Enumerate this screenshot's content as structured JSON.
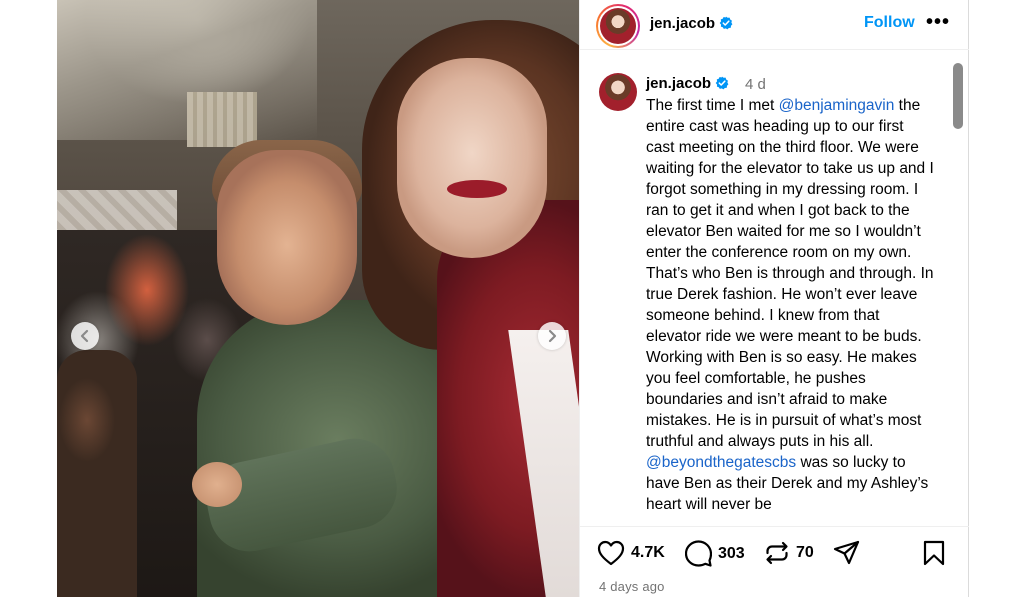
{
  "post": {
    "username": "jen.jacob",
    "follow_label": "Follow",
    "more_label": "•••"
  },
  "caption": {
    "username": "jen.jacob",
    "time": "4 d",
    "text_1": "The first time I met ",
    "mention_1": "@benjamingavin",
    "text_2": " the entire cast was heading up to our first cast meeting on the third floor. We were waiting for the elevator to take us up and I forgot something in my dressing room. I ran to get it and when I got back to the elevator Ben waited for me so I wouldn’t enter the conference room on my own. That’s who Ben is through and through. In true Derek fashion. He won’t ever leave someone behind. I knew from that elevator ride we were meant to be buds. Working with Ben is so easy. He makes you feel comfortable, he pushes boundaries and isn’t afraid to make mistakes. He is in pursuit of what’s most truthful and always puts in his all. ",
    "mention_2": "@beyondthegatescbs",
    "text_3": " was so lucky to have Ben as their Derek and my Ashley’s heart will never be"
  },
  "actions": {
    "likes": "4.7K",
    "comments": "303",
    "reposts": "70"
  },
  "timestamp": "4 days ago",
  "colors": {
    "accent": "#0095f6",
    "mention": "#1a64c9",
    "muted": "#737373"
  },
  "icons": [
    "verified-badge-icon",
    "heart-icon",
    "comment-icon",
    "repost-icon",
    "share-icon",
    "bookmark-icon",
    "chevron-left-icon",
    "chevron-right-icon"
  ]
}
